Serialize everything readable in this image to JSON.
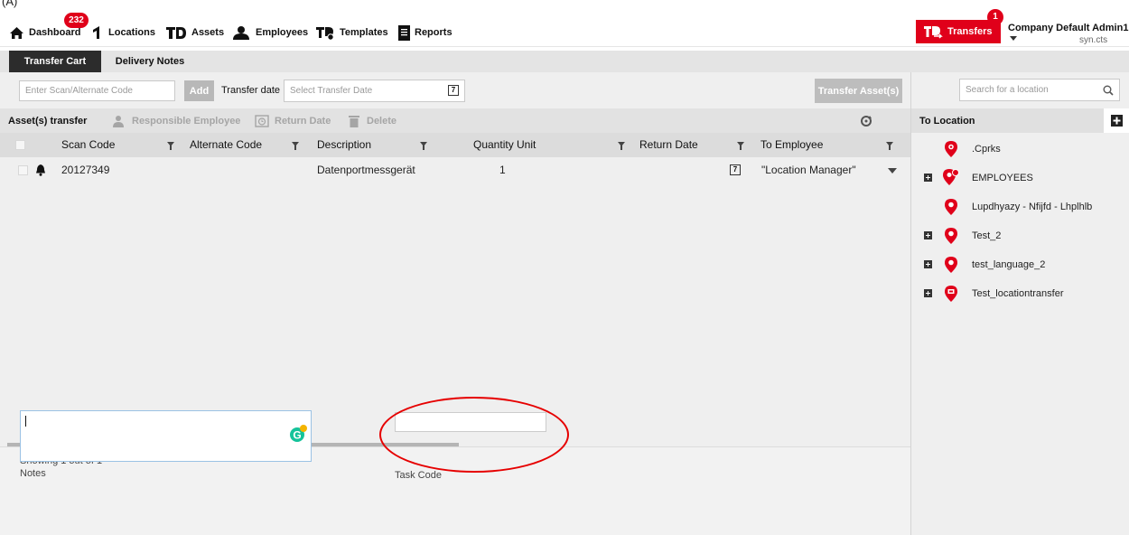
{
  "corner": "(A)",
  "nav": {
    "dashboard": "Dashboard",
    "dashboard_badge": "232",
    "locations": "Locations",
    "assets": "Assets",
    "employees": "Employees",
    "templates": "Templates",
    "reports": "Reports",
    "transfers": "Transfers",
    "transfers_badge": "1",
    "company": "Company Default Admin1",
    "company_sub": "syn.cts"
  },
  "tabs": {
    "transfer_cart": "Transfer Cart",
    "delivery_notes": "Delivery Notes"
  },
  "form": {
    "scan_placeholder": "Enter Scan/Alternate Code",
    "add": "Add",
    "transfer_date_label": "Transfer date",
    "transfer_date_placeholder": "Select Transfer Date",
    "calendar_day": "7",
    "transfer_assets": "Transfer Asset(s)"
  },
  "toolbar": {
    "asset_transfer": "Asset(s) transfer",
    "responsible_employee": "Responsible Employee",
    "return_date": "Return Date",
    "delete": "Delete"
  },
  "table": {
    "headers": {
      "scan_code": "Scan Code",
      "alternate_code": "Alternate Code",
      "description": "Description",
      "quantity": "Quantity",
      "unit": "Unit",
      "return_date": "Return Date",
      "to_employee": "To Employee"
    },
    "rows": [
      {
        "scan_code": "20127349",
        "alternate_code": "",
        "description": "Datenportmessgerät",
        "quantity": "1",
        "unit": "",
        "return_date_icon_day": "7",
        "to_employee": "\"Location Manager\""
      }
    ]
  },
  "footer": {
    "showing": "Showing 1 out of 1",
    "notes_label": "Notes",
    "task_code_label": "Task Code"
  },
  "right_panel": {
    "search_placeholder": "Search for a location",
    "header": "To Location",
    "locations": [
      {
        "label": ".Cprks",
        "expandable": false
      },
      {
        "label": "EMPLOYEES",
        "expandable": true
      },
      {
        "label": "Lupdhyazy - Nfijfd - Lhplhlb",
        "expandable": false
      },
      {
        "label": "Test_2",
        "expandable": true
      },
      {
        "label": "test_language_2",
        "expandable": true
      },
      {
        "label": "Test_locationtransfer",
        "expandable": true
      }
    ]
  },
  "colors": {
    "brand_red": "#e0001a",
    "dark_tab": "#2c2c2c",
    "annotation_red": "#e60000"
  }
}
